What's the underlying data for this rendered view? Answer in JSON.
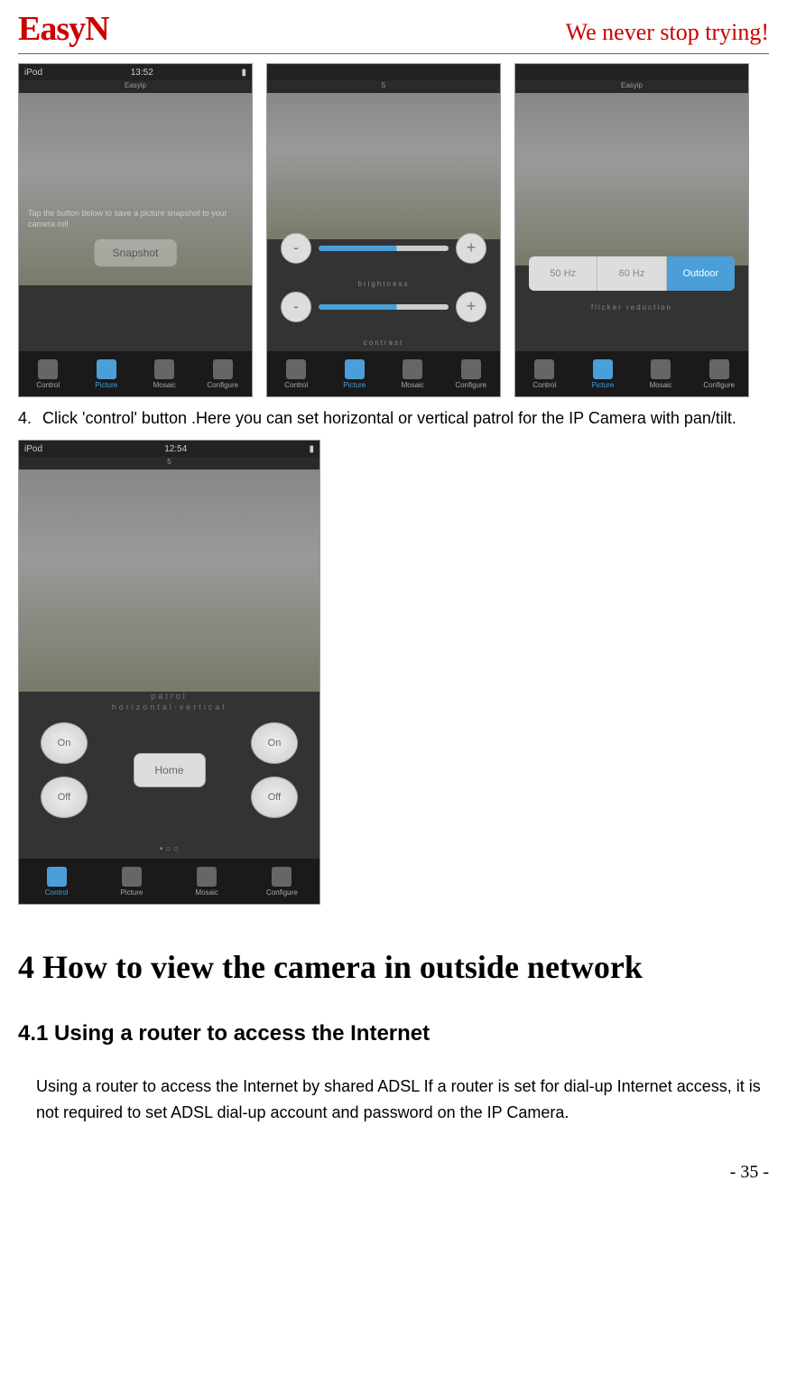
{
  "header": {
    "logo": "EasyN",
    "slogan": "We never stop trying!"
  },
  "screenshot1": {
    "statusLeft": "iPod",
    "statusTime": "13:52",
    "titleBar": "Easyip",
    "snapshotHint": "Tap the button below to save a picture snapshot to your camera roll",
    "snapshotBtn": "Snapshot",
    "tabs": {
      "control": "Control",
      "picture": "Picture",
      "mosaic": "Mosaic",
      "configure": "Configure"
    }
  },
  "screenshot2": {
    "titleBar": "5",
    "brightness": "brightness",
    "contrast": "contrast",
    "tabs": {
      "control": "Control",
      "picture": "Picture",
      "mosaic": "Mosaic",
      "configure": "Configure"
    }
  },
  "screenshot3": {
    "titleBar": "Easyip",
    "hz50": "50 Hz",
    "hz60": "60 Hz",
    "outdoor": "Outdoor",
    "flickerLabel": "flicker reduction",
    "tabs": {
      "control": "Control",
      "picture": "Picture",
      "mosaic": "Mosaic",
      "configure": "Configure"
    }
  },
  "step4": {
    "number": "4.",
    "text": "Click 'control' button .Here you can set horizontal or vertical patrol for the IP Camera with pan/tilt."
  },
  "screenshot4": {
    "statusLeft": "iPod",
    "statusTime": "12:54",
    "titleBar": "5",
    "patrolLabel1": "patrol",
    "patrolLabel2": "horizontal-vertical",
    "on": "On",
    "off": "Off",
    "home": "Home",
    "tabs": {
      "control": "Control",
      "picture": "Picture",
      "mosaic": "Mosaic",
      "configure": "Configure"
    }
  },
  "section": {
    "heading": "4 How to view the camera in outside network",
    "subheading": "4.1 Using a router to access the Internet",
    "body": "Using a router to access the Internet by shared ADSL If a router is set for dial-up Internet access, it is not required to set ADSL dial-up account and password on the IP Camera."
  },
  "pageNumber": "- 35 -"
}
